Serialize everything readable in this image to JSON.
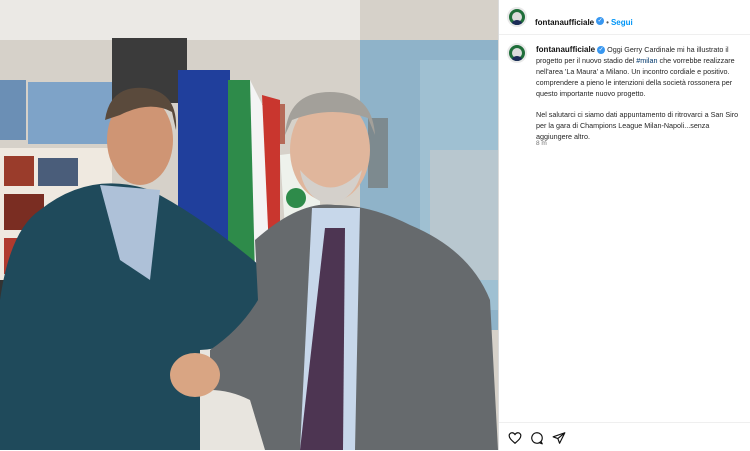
{
  "post": {
    "username": "fontanaufficiale",
    "dot": "•",
    "follow_label": "Segui",
    "caption_p1_a": "Oggi Gerry Cardinale mi ha illustrato il",
    "caption_p1_b_pre": "progetto per il nuovo stadio del ",
    "caption_p1_b_tag": "#milan",
    "caption_p1_b_post": " che vorrebbe realizzare",
    "caption_p1_c": "nell'area 'La Maura' a Milano. Un incontro cordiale e positivo.",
    "caption_p1_d": "comprendere a pieno le intenzioni della società rossonera per",
    "caption_p1_e": "questo importante nuovo progetto.",
    "caption_p2_a": "Nel salutarci ci siamo dati appuntamento di ritrovarci a San Siro",
    "caption_p2_b": "per la gara di Champions League Milan-Napoli...senza",
    "caption_p2_c": "aggiungere altro.",
    "time": "8 m"
  },
  "icons": {
    "verified": "verified-badge-icon",
    "like": "heart-icon",
    "comment": "comment-icon",
    "share": "share-icon"
  },
  "colors": {
    "link": "#0095f6",
    "hashtag": "#00376b",
    "verified": "#3897f0"
  }
}
